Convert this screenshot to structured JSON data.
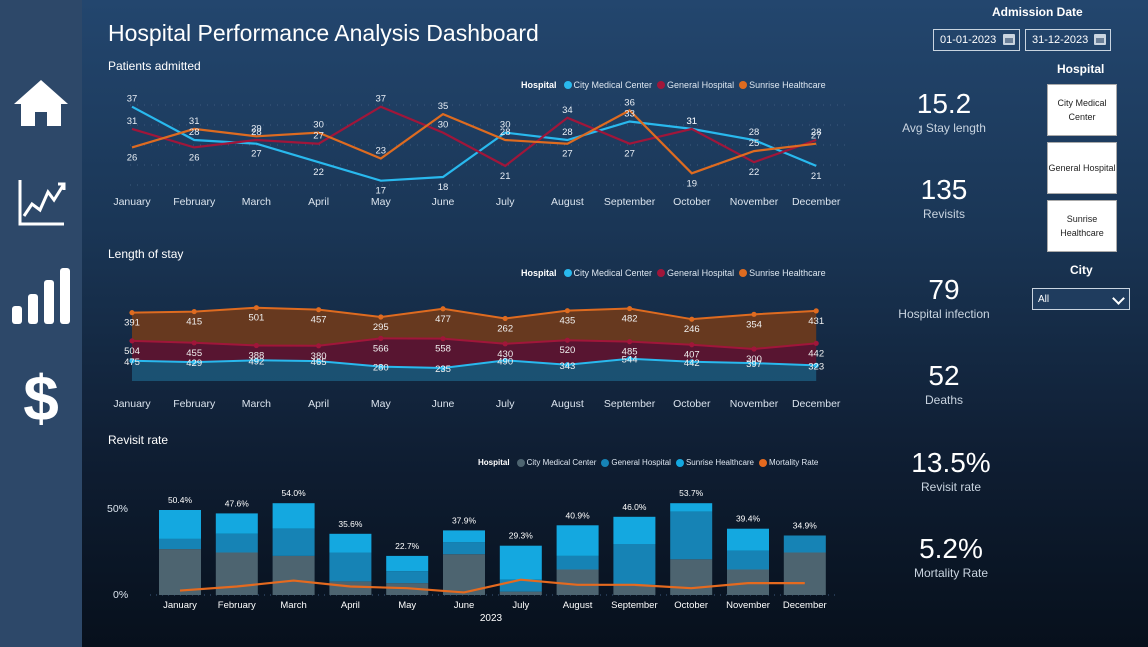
{
  "title": "Hospital Performance Analysis Dashboard",
  "months": [
    "January",
    "February",
    "March",
    "April",
    "May",
    "June",
    "July",
    "August",
    "September",
    "October",
    "November",
    "December"
  ],
  "colors": {
    "city": "#29b9ee",
    "general": "#a0163a",
    "sunrise": "#de6b20",
    "city_bar": "#4d6470",
    "general_bar": "#1683b5",
    "sunrise_bar": "#14a8e0",
    "mortality": "#e56a1f"
  },
  "icons": [
    "home-icon",
    "line-chart-icon",
    "bar-chart-icon",
    "dollar-icon"
  ],
  "legend_title": "Hospital",
  "legend_names": {
    "city": "City Medical Center",
    "general": "General Hospital",
    "sunrise": "Sunrise Healthcare",
    "mortality": "Mortality Rate"
  },
  "sections": {
    "patients": "Patients admitted",
    "stay": "Length of stay",
    "revisit": "Revisit rate"
  },
  "chart_data": [
    {
      "type": "line",
      "title": "Patients admitted",
      "x": [
        "January",
        "February",
        "March",
        "April",
        "May",
        "June",
        "July",
        "August",
        "September",
        "October",
        "November",
        "December"
      ],
      "series": [
        {
          "name": "City Medical Center",
          "values": [
            37,
            28,
            27,
            22,
            17,
            18,
            30,
            28,
            33,
            31,
            28,
            21
          ]
        },
        {
          "name": "General Hospital",
          "values": [
            31,
            26,
            28,
            27,
            37,
            30,
            21,
            34,
            27,
            31,
            22,
            28
          ]
        },
        {
          "name": "Sunrise Healthcare",
          "values": [
            26,
            31,
            29,
            30,
            23,
            35,
            28,
            27,
            36,
            19,
            25,
            27
          ]
        }
      ],
      "legend": "top-right"
    },
    {
      "type": "area",
      "title": "Length of stay",
      "x": [
        "January",
        "February",
        "March",
        "April",
        "May",
        "June",
        "July",
        "August",
        "September",
        "October",
        "November",
        "December"
      ],
      "series": [
        {
          "name": "City Medical Center",
          "values": [
            475,
            429,
            492,
            465,
            280,
            235,
            490,
            343,
            544,
            442,
            397,
            323
          ]
        },
        {
          "name": "General Hospital",
          "values": [
            504,
            455,
            388,
            380,
            566,
            558,
            430,
            520,
            485,
            407,
            300,
            442
          ]
        },
        {
          "name": "Sunrise Healthcare",
          "values": [
            391,
            415,
            501,
            457,
            295,
            477,
            262,
            435,
            482,
            246,
            354,
            431
          ]
        }
      ],
      "legend": "top-right"
    },
    {
      "type": "bar",
      "title": "Revisit rate",
      "xlabel": "2023",
      "categories": [
        "January",
        "February",
        "March",
        "April",
        "May",
        "June",
        "July",
        "August",
        "September",
        "October",
        "November",
        "December"
      ],
      "totals": [
        "50.4%",
        "47.6%",
        "54.0%",
        "35.6%",
        "22.7%",
        "37.9%",
        "29.3%",
        "40.9%",
        "46.0%",
        "53.7%",
        "39.4%",
        "34.9%"
      ],
      "series": [
        {
          "name": "City Medical Center",
          "values": [
            27,
            25,
            23,
            8,
            7,
            24,
            2,
            15,
            6,
            21,
            15,
            25
          ]
        },
        {
          "name": "General Hospital",
          "values": [
            6,
            11,
            16,
            17,
            7,
            7,
            7,
            8,
            24,
            28,
            11,
            10
          ]
        },
        {
          "name": "Sunrise Healthcare",
          "values": [
            17,
            12,
            15,
            11,
            9,
            7,
            20,
            18,
            16,
            5,
            13,
            0
          ]
        }
      ],
      "mortality": {
        "name": "Mortality Rate",
        "values": [
          2.6,
          5.0,
          8.5,
          5.0,
          4.0,
          1.5,
          9.0,
          6.0,
          6.0,
          4.0,
          7.0,
          7.0
        ]
      },
      "y_ticks": [
        "0%",
        "50%"
      ],
      "ylim": [
        0,
        60
      ],
      "legend": "top-right"
    }
  ],
  "kpis": [
    {
      "value": "15.2",
      "label": "Avg Stay length"
    },
    {
      "value": "135",
      "label": "Revisits"
    },
    {
      "value": "79",
      "label": "Hospital infection"
    },
    {
      "value": "52",
      "label": "Deaths"
    },
    {
      "value": "13.5%",
      "label": "Revisit rate"
    },
    {
      "value": "5.2%",
      "label": "Mortality Rate"
    }
  ],
  "filters": {
    "admission_title": "Admission Date",
    "date_from": "01-01-2023",
    "date_to": "31-12-2023",
    "hospital_title": "Hospital",
    "hospital_buttons": [
      "City Medical Center",
      "General Hospital",
      "Sunrise Healthcare"
    ],
    "city_title": "City",
    "city_value": "All"
  }
}
